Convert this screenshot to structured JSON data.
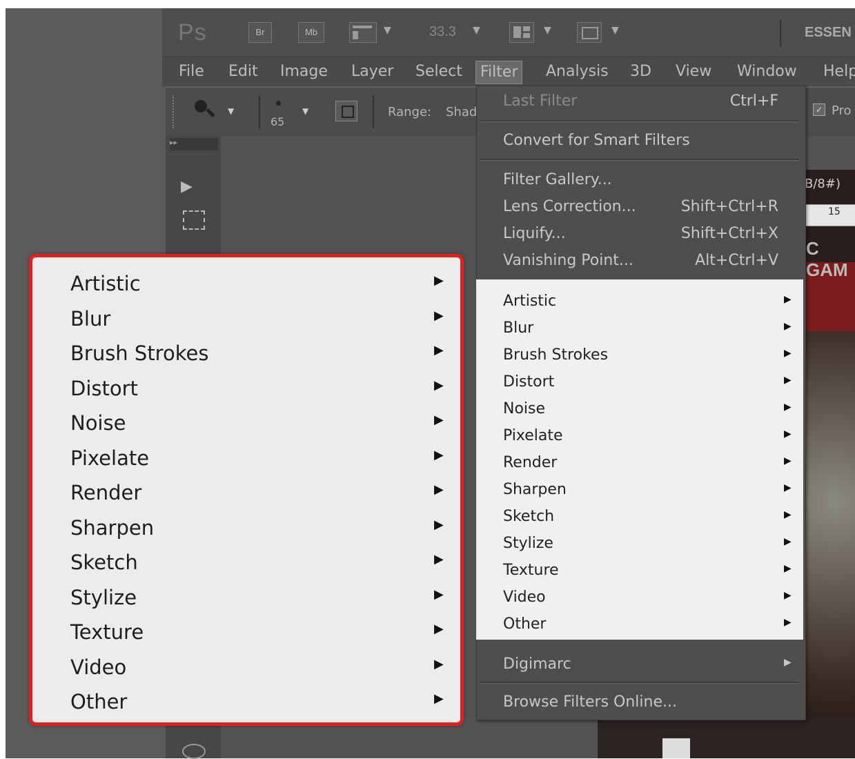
{
  "appbar": {
    "logo": "Ps",
    "bridge_label": "Br",
    "minibridge_label": "Mb",
    "zoom_value": "33.3",
    "workspace_label": "ESSEN"
  },
  "menubar": {
    "items": [
      "File",
      "Edit",
      "Image",
      "Layer",
      "Select",
      "Filter",
      "Analysis",
      "3D",
      "View",
      "Window",
      "Help"
    ]
  },
  "options": {
    "brush_size": "65",
    "range_label": "Range:",
    "range_value": "Shad",
    "protect_label": "Pro"
  },
  "filter_menu": {
    "last_filter": "Last Filter",
    "last_filter_shortcut": "Ctrl+F",
    "convert_smart": "Convert for Smart Filters",
    "gallery": "Filter Gallery...",
    "lens_correction": "Lens Correction...",
    "lens_correction_shortcut": "Shift+Ctrl+R",
    "liquify": "Liquify...",
    "liquify_shortcut": "Shift+Ctrl+X",
    "vanishing_point": "Vanishing Point...",
    "vanishing_point_shortcut": "Alt+Ctrl+V",
    "categories": [
      "Artistic",
      "Blur",
      "Brush Strokes",
      "Distort",
      "Noise",
      "Pixelate",
      "Render",
      "Sharpen",
      "Sketch",
      "Stylize",
      "Texture",
      "Video",
      "Other"
    ],
    "digimarc": "Digimarc",
    "browse_online": "Browse Filters Online..."
  },
  "zoom_panel": {
    "categories": [
      "Artistic",
      "Blur",
      "Brush Strokes",
      "Distort",
      "Noise",
      "Pixelate",
      "Render",
      "Sharpen",
      "Sketch",
      "Stylize",
      "Texture",
      "Video",
      "Other"
    ],
    "border_color": "#e01f1f"
  },
  "document": {
    "tab_fragment": "B/8#)",
    "ruler_number": "15",
    "poster_text": "C GAM"
  }
}
